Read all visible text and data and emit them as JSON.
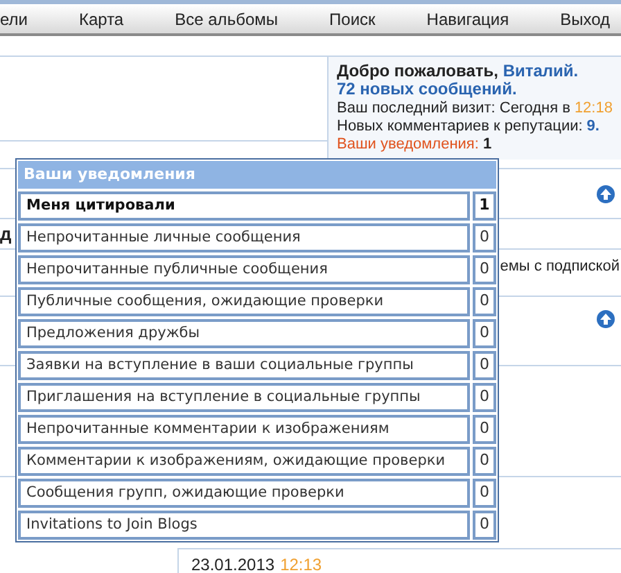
{
  "nav": [
    "ели",
    "Карта",
    "Все альбомы",
    "Поиск",
    "Навигация",
    "Выход"
  ],
  "welcome": {
    "greeting": "Добро пожаловать,",
    "name": "Виталий.",
    "new_messages": "72 новых сообщений.",
    "last_visit_label": "Ваш последний визит: Сегодня в",
    "last_visit_time": "12:18",
    "reputation_label": "Новых комментариев к репутации:",
    "reputation_count": "9.",
    "notifications_label": "Ваши уведомления:",
    "notifications_count": "1"
  },
  "background": {
    "heading_fragment": "д",
    "subscription_fragment": "емы с подпиской",
    "date": "23.01.2013",
    "time": "12:13"
  },
  "notifications": {
    "title": "Ваши уведомления",
    "rows": [
      {
        "label": "Меня цитировали",
        "count": "1",
        "highlighted": true
      },
      {
        "label": "Непрочитанные личные сообщения",
        "count": "0",
        "highlighted": false
      },
      {
        "label": "Непрочитанные публичные сообщения",
        "count": "0",
        "highlighted": false
      },
      {
        "label": "Публичные сообщения, ожидающие проверки",
        "count": "0",
        "highlighted": false
      },
      {
        "label": "Предложения дружбы",
        "count": "0",
        "highlighted": false
      },
      {
        "label": "Заявки на вступление в ваши социальные группы",
        "count": "0",
        "highlighted": false
      },
      {
        "label": "Приглашения на вступление в социальные группы",
        "count": "0",
        "highlighted": false
      },
      {
        "label": "Непрочитанные комментарии к изображениям",
        "count": "0",
        "highlighted": false
      },
      {
        "label": "Комментарии к изображениям, ожидающие проверки",
        "count": "0",
        "highlighted": false
      },
      {
        "label": "Сообщения групп, ожидающие проверки",
        "count": "0",
        "highlighted": false
      },
      {
        "label": "Invitations to Join Blogs",
        "count": "0",
        "highlighted": false
      }
    ]
  }
}
